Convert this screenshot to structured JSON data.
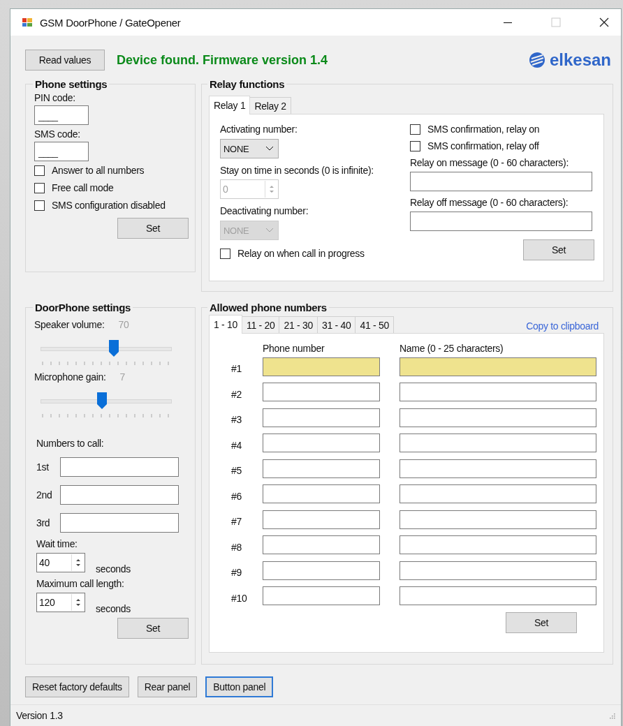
{
  "window": {
    "title": "GSM DoorPhone / GateOpener"
  },
  "toolbar": {
    "read_button": "Read values",
    "status": "Device found. Firmware version 1.4",
    "logo": "elkesan"
  },
  "phone_settings": {
    "title": "Phone settings",
    "fields": [
      {
        "label": "PIN code:",
        "value": "____"
      },
      {
        "label": "SMS code:",
        "value": "____"
      }
    ],
    "checkboxes": [
      {
        "label": "Answer to all numbers",
        "checked": false
      },
      {
        "label": "Free call mode",
        "checked": false
      },
      {
        "label": "SMS configuration disabled",
        "checked": false
      }
    ],
    "set_button": "Set"
  },
  "relay_functions": {
    "title": "Relay functions",
    "tabs": [
      {
        "label": "Relay 1",
        "selected": true
      },
      {
        "label": "Relay 2",
        "selected": false
      }
    ],
    "activating": {
      "label": "Activating number:",
      "value": "NONE",
      "disabled": false
    },
    "stay_on": {
      "label": "Stay on time in seconds (0 is infinite):",
      "value": "0",
      "disabled": true
    },
    "deactivating": {
      "label": "Deactivating number:",
      "value": "NONE",
      "disabled": true
    },
    "call_checkbox": {
      "label": "Relay on when call in progress",
      "checked": false
    },
    "sms_checkboxes": [
      {
        "label": "SMS confirmation, relay on",
        "checked": false
      },
      {
        "label": "SMS confirmation, relay off",
        "checked": false
      }
    ],
    "messages": [
      {
        "label": "Relay on message (0 - 60 characters):"
      },
      {
        "label": "Relay off message (0 - 60 characters):"
      }
    ],
    "set_button": "Set"
  },
  "doorphone": {
    "title": "DoorPhone settings",
    "sliders": [
      {
        "label": "Speaker volume:",
        "reading": "70",
        "level": 0.56
      },
      {
        "label": "Microphone gain:",
        "reading": "7",
        "level": 0.47
      }
    ],
    "numbers_label": "Numbers to call:",
    "numbers": [
      {
        "label": "1st"
      },
      {
        "label": "2nd"
      },
      {
        "label": "3rd"
      }
    ],
    "spinners": [
      {
        "label": "Wait time:",
        "value": "40",
        "unit": "seconds"
      },
      {
        "label": "Maximum call length:",
        "value": "120",
        "unit": "seconds"
      }
    ],
    "set_button": "Set"
  },
  "allowed": {
    "title": "Allowed phone numbers",
    "copy_link": "Copy to clipboard",
    "tabs": [
      {
        "label": "1 - 10",
        "selected": true
      },
      {
        "label": "11 - 20",
        "selected": false
      },
      {
        "label": "21 - 30",
        "selected": false
      },
      {
        "label": "31 - 40",
        "selected": false
      },
      {
        "label": "41 - 50",
        "selected": false
      }
    ],
    "columns": [
      "Phone number",
      "Name (0 - 25 characters)"
    ],
    "rows": [
      {
        "label": "#1",
        "highlighted": true
      },
      {
        "label": "#2",
        "highlighted": false
      },
      {
        "label": "#3",
        "highlighted": false
      },
      {
        "label": "#4",
        "highlighted": false
      },
      {
        "label": "#5",
        "highlighted": false
      },
      {
        "label": "#6",
        "highlighted": false
      },
      {
        "label": "#7",
        "highlighted": false
      },
      {
        "label": "#8",
        "highlighted": false
      },
      {
        "label": "#9",
        "highlighted": false
      },
      {
        "label": "#10",
        "highlighted": false
      }
    ],
    "set_button": "Set"
  },
  "bottom_buttons": [
    {
      "label": "Reset factory defaults",
      "focused": false
    },
    {
      "label": "Rear panel",
      "focused": false
    },
    {
      "label": "Button panel",
      "focused": true
    }
  ],
  "status_bar": {
    "text": "Version 1.3"
  }
}
